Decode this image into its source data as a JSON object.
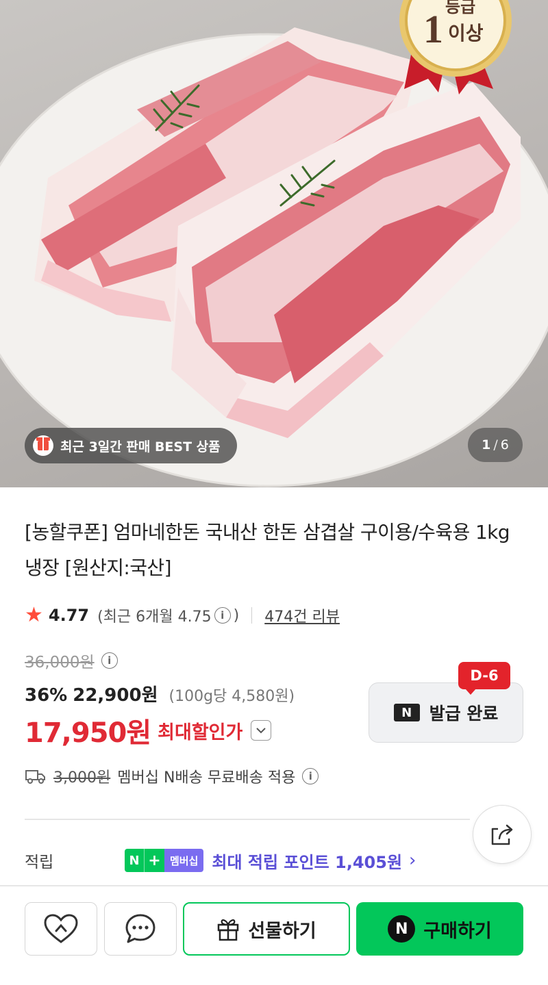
{
  "hero": {
    "badge_text": "최근 3일간 판매 BEST 상품",
    "medal_top": "등급",
    "medal_text": "이상",
    "medal_num": "1",
    "counter_current": "1",
    "counter_total": "6"
  },
  "product": {
    "title": "[농할쿠폰] 엄마네한돈 국내산 한돈 삼겹살 구이용/수육용 1kg 냉장 [원산지:국산]",
    "rating": "4.77",
    "rating_recent": "(최근 6개월 4.75",
    "rating_recent_close": ")",
    "review_link": "474건 리뷰"
  },
  "price": {
    "original": "36,000원",
    "discount_pct": "36%",
    "sale": "22,900원",
    "per_unit": "(100g당 4,580원)",
    "best": "17,950원",
    "best_label": "최대할인가"
  },
  "coupon": {
    "dday": "D-6",
    "logo": "N",
    "status": "발급 완료"
  },
  "shipping": {
    "old_fee": "3,000원",
    "text": "멤버십 N배송 무료배송 적용"
  },
  "points": {
    "label": "적립",
    "badge_n": "N",
    "badge_plus": "+",
    "badge_member": "멤버십",
    "text": "최대 적립 포인트 1,405원"
  },
  "actions": {
    "gift_label": "선물하기",
    "buy_logo": "N",
    "buy_label": "구매하기"
  },
  "colors": {
    "accent_green": "#03c75a",
    "sale_red": "#e02a35",
    "dday_red": "#e3232b",
    "member_purple": "#5a4fd6",
    "star": "#ff4d3a"
  },
  "icons": [
    "gift-icon",
    "medal-icon",
    "info-icon",
    "star-icon",
    "chevron-down-icon",
    "truck-icon",
    "share-icon",
    "heart-icon",
    "chat-icon",
    "present-icon",
    "naver-n-icon",
    "chevron-right-icon"
  ]
}
